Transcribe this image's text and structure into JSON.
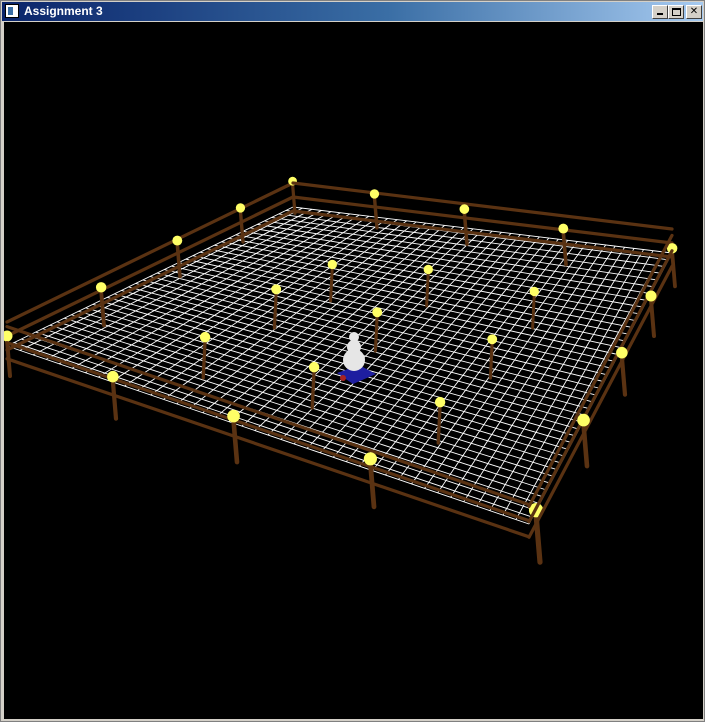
{
  "window": {
    "title": "Assignment 3",
    "icon": "app-window-icon",
    "controls": {
      "minimize": "minimize-icon",
      "maximize": "maximize-icon",
      "close": "close-icon",
      "close_glyph": "✕"
    }
  },
  "scene": {
    "background": "#000000",
    "grid_color": "#ffffff",
    "fence_color": "#5a3212",
    "lamp_color": "#ffff66",
    "snowman_color": "#e6e6e6",
    "snowman_base_color": "#1e1ea0"
  }
}
